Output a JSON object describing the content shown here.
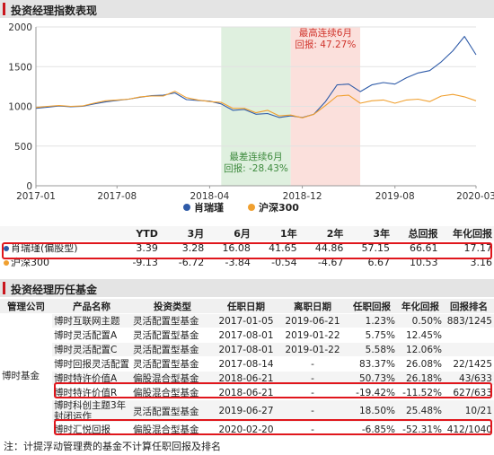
{
  "section1": {
    "title": "投资经理指数表现"
  },
  "section2": {
    "title": "投资经理历任基金"
  },
  "colors": {
    "manager": "#2f5ba8",
    "hs300": "#f0a030",
    "up_band": "#fbe0dc",
    "down_band": "#dff0df",
    "highlight": "#e0161c"
  },
  "chart_data": {
    "type": "line",
    "title": "",
    "xlabel": "",
    "ylabel": "",
    "ylim": [
      0,
      2000
    ],
    "y_ticks": [
      0,
      500,
      1000,
      1500,
      2000
    ],
    "x_ticks": [
      "2017-01",
      "2017-08",
      "2018-04",
      "2018-12",
      "2019-08",
      "2020-03"
    ],
    "legend_position": "bottom",
    "grid": "horizontal",
    "series": [
      {
        "name": "肖瑞瑾",
        "color": "#2f5ba8",
        "points": [
          [
            "2017-01",
            975
          ],
          [
            "2017-02",
            990
          ],
          [
            "2017-03",
            1005
          ],
          [
            "2017-04",
            995
          ],
          [
            "2017-05",
            1000
          ],
          [
            "2017-06",
            1030
          ],
          [
            "2017-07",
            1055
          ],
          [
            "2017-08",
            1075
          ],
          [
            "2017-09",
            1090
          ],
          [
            "2017-10",
            1115
          ],
          [
            "2017-11",
            1135
          ],
          [
            "2017-12",
            1140
          ],
          [
            "2018-01",
            1170
          ],
          [
            "2018-02",
            1085
          ],
          [
            "2018-03",
            1075
          ],
          [
            "2018-04",
            1065
          ],
          [
            "2018-05",
            1030
          ],
          [
            "2018-06",
            950
          ],
          [
            "2018-07",
            960
          ],
          [
            "2018-08",
            900
          ],
          [
            "2018-09",
            910
          ],
          [
            "2018-10",
            860
          ],
          [
            "2018-11",
            880
          ],
          [
            "2018-12",
            860
          ],
          [
            "2019-01",
            900
          ],
          [
            "2019-02",
            1060
          ],
          [
            "2019-03",
            1270
          ],
          [
            "2019-04",
            1280
          ],
          [
            "2019-05",
            1185
          ],
          [
            "2019-06",
            1270
          ],
          [
            "2019-07",
            1300
          ],
          [
            "2019-08",
            1280
          ],
          [
            "2019-09",
            1360
          ],
          [
            "2019-10",
            1420
          ],
          [
            "2019-11",
            1450
          ],
          [
            "2019-12",
            1560
          ],
          [
            "2020-01",
            1700
          ],
          [
            "2020-02",
            1880
          ],
          [
            "2020-03",
            1650
          ]
        ]
      },
      {
        "name": "沪深300",
        "color": "#f0a030",
        "points": [
          [
            "2017-01",
            985
          ],
          [
            "2017-02",
            1000
          ],
          [
            "2017-03",
            1010
          ],
          [
            "2017-04",
            1000
          ],
          [
            "2017-05",
            1005
          ],
          [
            "2017-06",
            1040
          ],
          [
            "2017-07",
            1070
          ],
          [
            "2017-08",
            1080
          ],
          [
            "2017-09",
            1090
          ],
          [
            "2017-10",
            1120
          ],
          [
            "2017-11",
            1130
          ],
          [
            "2017-12",
            1130
          ],
          [
            "2018-01",
            1190
          ],
          [
            "2018-02",
            1110
          ],
          [
            "2018-03",
            1080
          ],
          [
            "2018-04",
            1060
          ],
          [
            "2018-05",
            1050
          ],
          [
            "2018-06",
            975
          ],
          [
            "2018-07",
            975
          ],
          [
            "2018-08",
            920
          ],
          [
            "2018-09",
            950
          ],
          [
            "2018-10",
            880
          ],
          [
            "2018-11",
            890
          ],
          [
            "2018-12",
            855
          ],
          [
            "2019-01",
            900
          ],
          [
            "2019-02",
            1010
          ],
          [
            "2019-03",
            1130
          ],
          [
            "2019-04",
            1140
          ],
          [
            "2019-05",
            1040
          ],
          [
            "2019-06",
            1070
          ],
          [
            "2019-07",
            1080
          ],
          [
            "2019-08",
            1040
          ],
          [
            "2019-09",
            1080
          ],
          [
            "2019-10",
            1090
          ],
          [
            "2019-11",
            1060
          ],
          [
            "2019-12",
            1130
          ],
          [
            "2020-01",
            1150
          ],
          [
            "2020-02",
            1120
          ],
          [
            "2020-03",
            1070
          ]
        ]
      }
    ],
    "bands": [
      {
        "from": "2018-05",
        "to": "2018-11",
        "kind": "down",
        "label_line1": "最差连续6月",
        "label_line2": "回报: -28.43%"
      },
      {
        "from": "2018-11",
        "to": "2019-05",
        "kind": "up",
        "label_line1": "最高连续6月",
        "label_line2": "回报: 47.27%"
      }
    ]
  },
  "perf_table": {
    "headers": [
      "",
      "YTD",
      "3月",
      "6月",
      "1年",
      "2年",
      "3年",
      "总回报",
      "年化回报"
    ],
    "rows": [
      {
        "name": "肖瑞瑾(偏股型)",
        "values": [
          "3.39",
          "3.28",
          "16.08",
          "41.65",
          "44.86",
          "57.15",
          "66.61",
          "17.17"
        ]
      },
      {
        "name": "沪深300",
        "values": [
          "-9.13",
          "-6.72",
          "-3.84",
          "-0.54",
          "-4.67",
          "6.67",
          "10.53",
          "3.16"
        ]
      }
    ]
  },
  "history_table": {
    "headers": [
      "管理公司",
      "产品名称",
      "投资类型",
      "任职日期",
      "离职日期",
      "任职回报",
      "年化回报",
      "回报排名"
    ],
    "company": "博时基金",
    "rows": [
      [
        "博时互联网主题",
        "灵活配置型基金",
        "2017-01-05",
        "2019-06-21",
        "1.23%",
        "0.50%",
        "883/1245"
      ],
      [
        "博时灵活配置A",
        "灵活配置型基金",
        "2017-08-01",
        "2019-01-22",
        "5.75%",
        "12.45%",
        ""
      ],
      [
        "博时灵活配置C",
        "灵活配置型基金",
        "2017-08-01",
        "2019-01-22",
        "5.58%",
        "12.06%",
        ""
      ],
      [
        "博时回报灵活配置",
        "灵活配置型基金",
        "2017-08-14",
        "-",
        "83.37%",
        "26.08%",
        "22/1425"
      ],
      [
        "博时特许价值A",
        "偏股混合型基金",
        "2018-06-21",
        "-",
        "50.73%",
        "26.18%",
        "43/633"
      ],
      [
        "博时特许价值R",
        "偏股混合型基金",
        "2018-06-21",
        "-",
        "-19.42%",
        "-11.52%",
        "627/633"
      ],
      [
        "博时科创主题3年封闭运作",
        "灵活配置型基金",
        "2019-06-27",
        "-",
        "18.50%",
        "25.48%",
        "10/21"
      ],
      [
        "博时汇悦回报",
        "偏股混合型基金",
        "2020-02-20",
        "-",
        "-6.85%",
        "-52.31%",
        "412/1040"
      ]
    ]
  },
  "note": "注：计提浮动管理费的基金不计算任职回报及排名"
}
